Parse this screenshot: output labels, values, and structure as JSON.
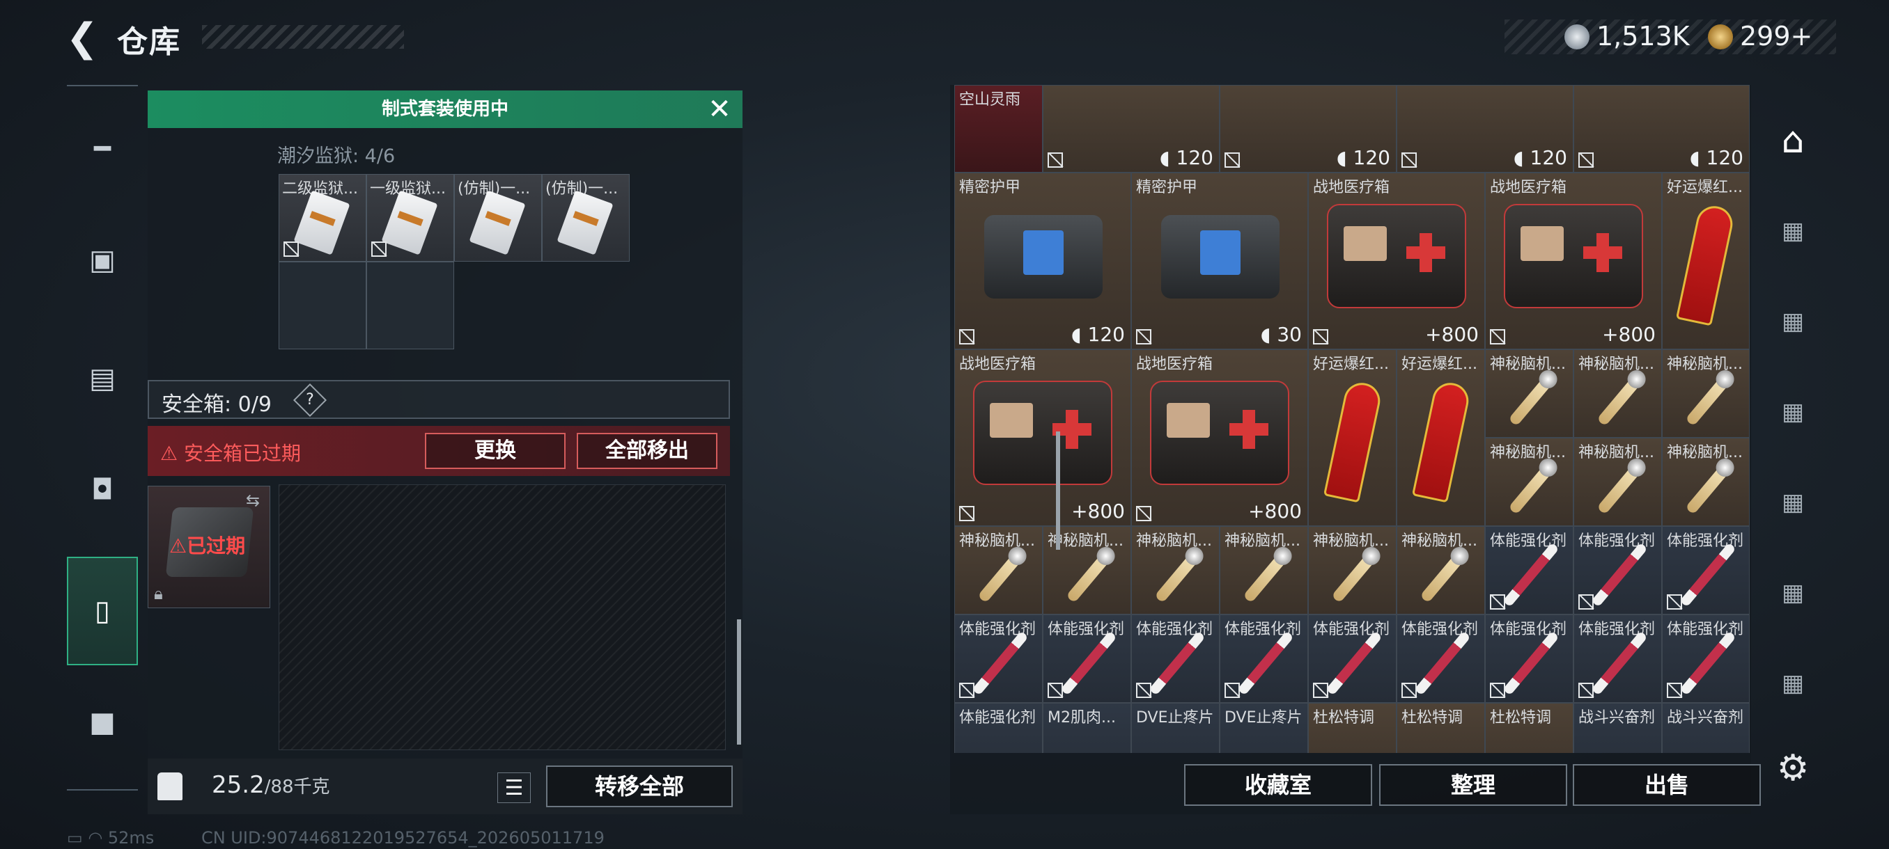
{
  "header": {
    "back_icon": "chevron-left-icon",
    "title": "仓库"
  },
  "currency": {
    "silver": "1,513K",
    "gold": "299+"
  },
  "left_nav": {
    "items": [
      {
        "name": "weapons",
        "icon": "gun-icon"
      },
      {
        "name": "armor",
        "icon": "vest-icon"
      },
      {
        "name": "backpack",
        "icon": "backpack-icon"
      },
      {
        "name": "bag",
        "icon": "bag-icon"
      },
      {
        "name": "container",
        "icon": "clipboard-icon",
        "active": true
      },
      {
        "name": "toolbox",
        "icon": "toolbox-icon"
      }
    ]
  },
  "suit": {
    "title": "制式套装使用中",
    "prison_label": "潮汐监狱: 4/6",
    "slots": [
      "二级监狱...",
      "一级监狱...",
      "(仿制)一...",
      "(仿制)一..."
    ]
  },
  "safebox": {
    "label": "安全箱: 0/9",
    "help": "?",
    "expired": "安全箱已过期",
    "replace": "更换",
    "remove_all": "全部移出",
    "case_status": "已过期"
  },
  "weight": {
    "current": "25.2",
    "max": "/88千克",
    "transfer": "转移全部"
  },
  "items": {
    "row0": [
      {
        "label": "空山灵雨"
      },
      {
        "val": "120"
      },
      {
        "val": "120"
      },
      {
        "val": "120"
      },
      {
        "val": "120"
      }
    ],
    "row1": [
      {
        "label": "精密护甲",
        "val": "120"
      },
      {
        "label": "精密护甲",
        "val": "30"
      },
      {
        "label": "战地医疗箱",
        "val": "+800"
      },
      {
        "label": "战地医疗箱",
        "val": "+800"
      },
      {
        "label": "好运爆红..."
      }
    ],
    "row2": [
      {
        "label": "战地医疗箱",
        "val": "+800"
      },
      {
        "label": "战地医疗箱",
        "val": "+800"
      },
      {
        "label": "好运爆红..."
      },
      {
        "label": "好运爆红..."
      },
      {
        "label": "神秘脑机..."
      },
      {
        "label": "神秘脑机..."
      },
      {
        "label": "神秘脑机..."
      }
    ],
    "row3": [
      {
        "label": "神秘脑机..."
      },
      {
        "label": "神秘脑机..."
      },
      {
        "label": "神秘脑机..."
      }
    ],
    "row4": [
      {
        "label": "神秘脑机..."
      },
      {
        "label": "神秘脑机..."
      },
      {
        "label": "神秘脑机..."
      },
      {
        "label": "神秘脑机..."
      },
      {
        "label": "神秘脑机..."
      },
      {
        "label": "神秘脑机..."
      },
      {
        "label": "体能强化剂"
      },
      {
        "label": "体能强化剂"
      },
      {
        "label": "体能强化剂"
      }
    ],
    "row5": [
      {
        "label": "体能强化剂"
      },
      {
        "label": "体能强化剂"
      },
      {
        "label": "体能强化剂"
      },
      {
        "label": "体能强化剂"
      },
      {
        "label": "体能强化剂"
      },
      {
        "label": "体能强化剂"
      },
      {
        "label": "体能强化剂"
      },
      {
        "label": "体能强化剂"
      },
      {
        "label": "体能强化剂"
      }
    ],
    "row6": [
      {
        "label": "体能强化剂"
      },
      {
        "label": "M2肌肉..."
      },
      {
        "label": "DVE止疼片"
      },
      {
        "label": "DVE止疼片"
      },
      {
        "label": "杜松特调"
      },
      {
        "label": "杜松特调"
      },
      {
        "label": "杜松特调"
      },
      {
        "label": "战斗兴奋剂"
      },
      {
        "label": "战斗兴奋剂"
      }
    ]
  },
  "actions": {
    "collection": "收藏室",
    "sort": "整理",
    "sell": "出售"
  },
  "status": {
    "ping": "52ms",
    "uid": "CN UID:9074468122019527654_202605011719"
  }
}
